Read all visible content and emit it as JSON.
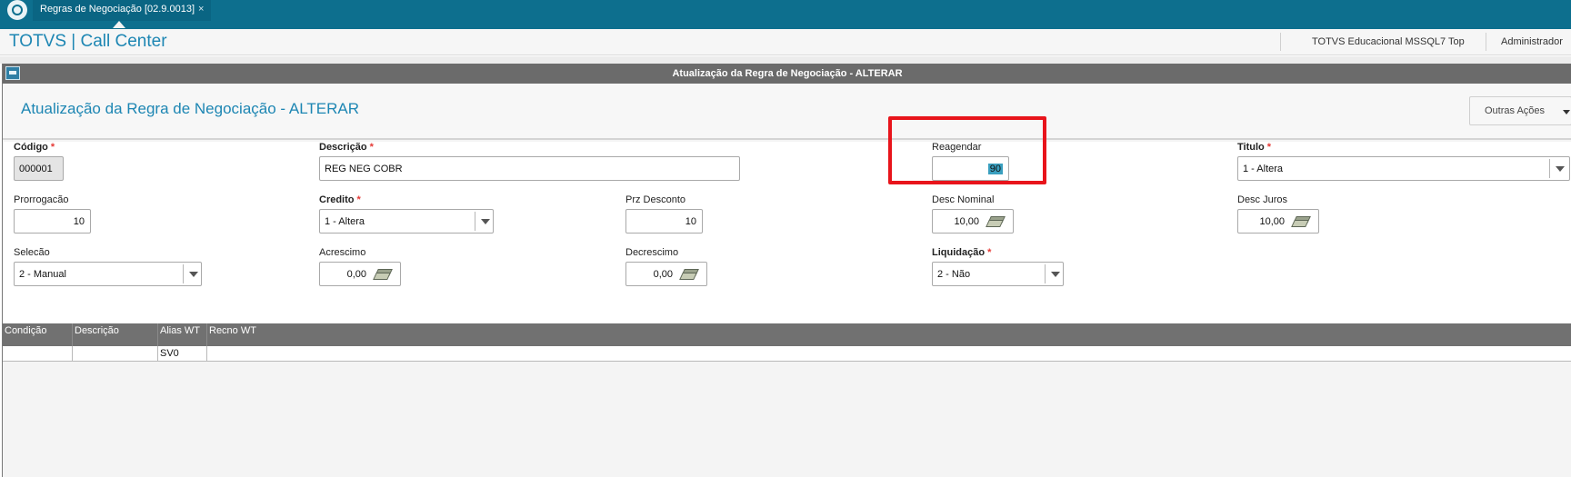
{
  "tab": {
    "label": "Regras de Negociação [02.9.0013]",
    "close": "×"
  },
  "header": {
    "app_title": "TOTVS | Call Center",
    "environment": "TOTVS Educacional MSSQL7 Top",
    "user": "Administrador"
  },
  "window": {
    "title": "Atualização da Regra de Negociação - ALTERAR"
  },
  "page": {
    "title": "Atualização da Regra de Negociação - ALTERAR",
    "actions_label": "Outras Ações"
  },
  "form": {
    "codigo": {
      "label": "Código",
      "required_mark": "*",
      "value": "000001"
    },
    "descricao": {
      "label": "Descrição",
      "required_mark": "*",
      "value": "REG NEG COBR"
    },
    "reagendar": {
      "label": "Reagendar",
      "value": "90"
    },
    "titulo": {
      "label": "Titulo",
      "required_mark": "*",
      "value": "1 - Altera"
    },
    "prorrogacao": {
      "label": "Prorrogacão",
      "value": "10"
    },
    "credito": {
      "label": "Credito",
      "required_mark": "*",
      "value": "1 - Altera"
    },
    "prz_desconto": {
      "label": "Prz Desconto",
      "value": "10"
    },
    "desc_nominal": {
      "label": "Desc Nominal",
      "value": "10,00"
    },
    "desc_juros": {
      "label": "Desc Juros",
      "value": "10,00"
    },
    "selecao": {
      "label": "Selecão",
      "value": "2 - Manual"
    },
    "acrescimo": {
      "label": "Acrescimo",
      "value": "0,00"
    },
    "decrescimo": {
      "label": "Decrescimo",
      "value": "0,00"
    },
    "liquidacao": {
      "label": "Liquidação",
      "required_mark": "*",
      "value": "2 - Não"
    }
  },
  "grid": {
    "columns": [
      "Condição",
      "Descrição",
      "Alias WT",
      "Recno WT"
    ],
    "rows": [
      [
        "",
        "",
        "SV0",
        ""
      ]
    ]
  },
  "colors": {
    "top_bar": "#0d6f8e",
    "brand_blue": "#1d86b3",
    "highlight_red": "#e8141b",
    "required_star": "#e53935",
    "selection": "#3a9fbf"
  },
  "icons": [
    "totvs-logo-icon",
    "window-icon",
    "chevron-down-icon",
    "money-icon"
  ]
}
